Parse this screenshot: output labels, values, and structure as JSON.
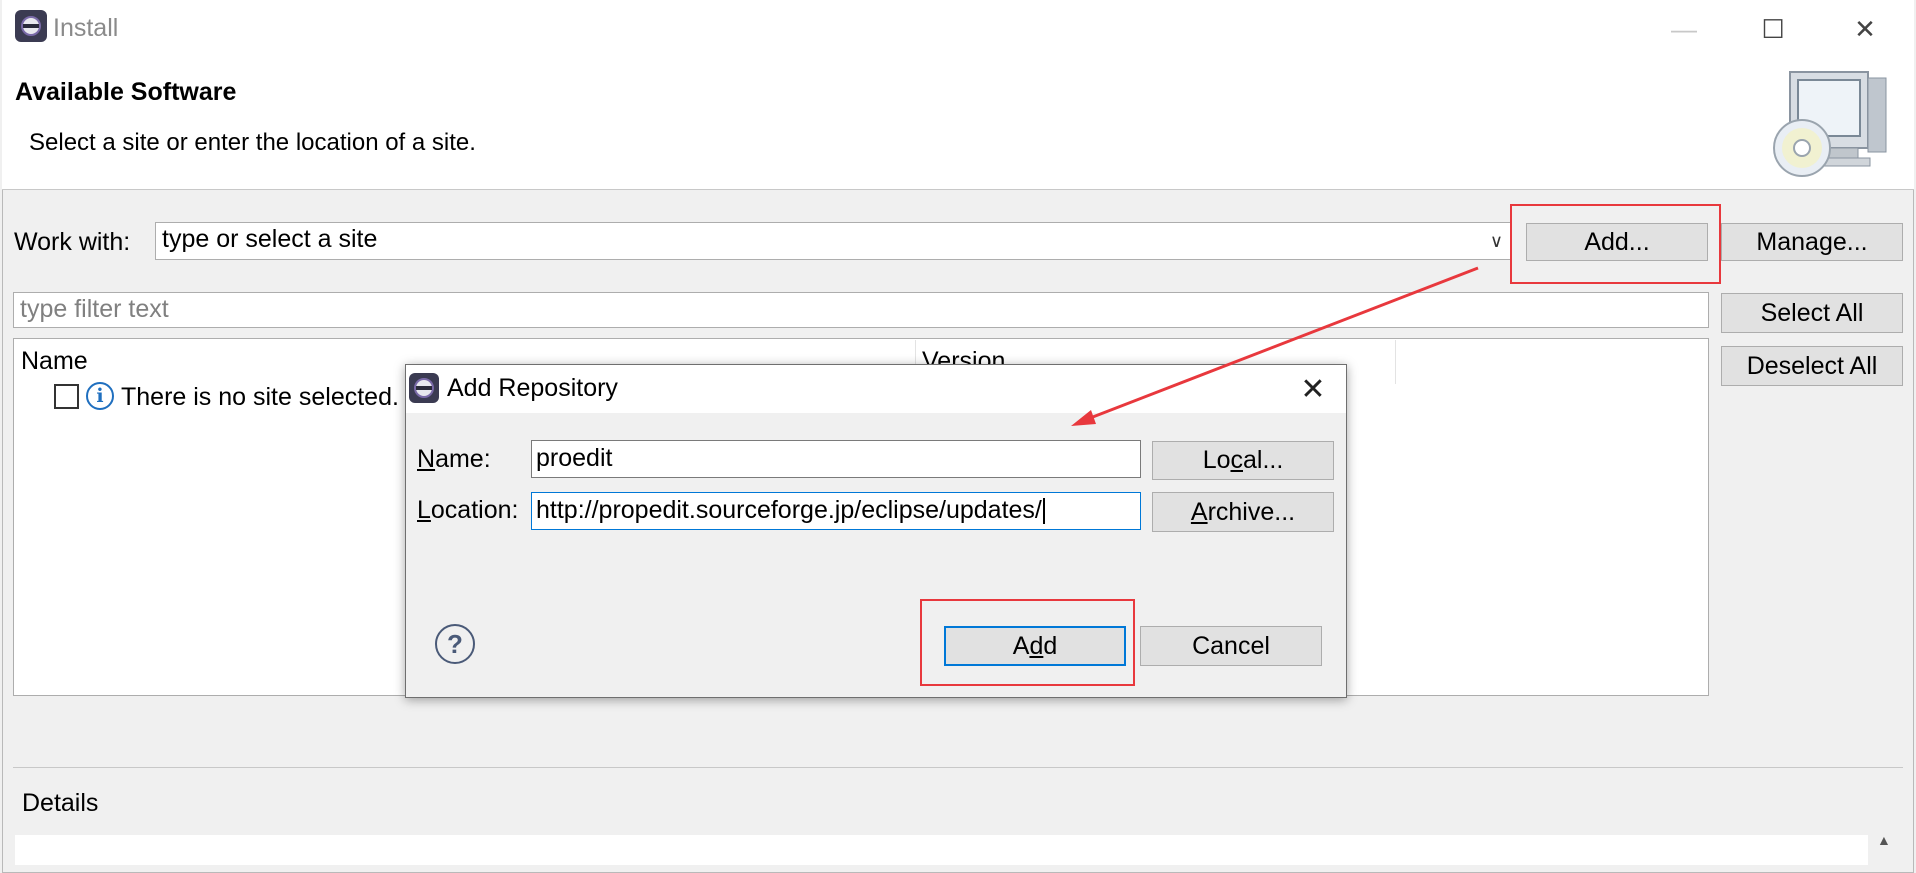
{
  "window": {
    "title": "Install"
  },
  "header": {
    "title": "Available Software",
    "description": "Select a site or enter the location of a site."
  },
  "work_with": {
    "label": "Work with:",
    "combo_value": "type or select a site",
    "add_button": "Add...",
    "manage_button": "Manage..."
  },
  "filter": {
    "placeholder": "type filter text"
  },
  "side_buttons": {
    "select_all": "Select All",
    "deselect_all": "Deselect All"
  },
  "table": {
    "columns": [
      "Name",
      "Version"
    ],
    "rows": [
      {
        "text": "There is no site selected."
      }
    ]
  },
  "details": {
    "label": "Details"
  },
  "dialog": {
    "title": "Add Repository",
    "name_label": "Name:",
    "name_value": "proedit",
    "location_label": "Location:",
    "location_value": "http://propedit.sourceforge.jp/eclipse/updates/",
    "local_button": "Local...",
    "archive_button": "Archive...",
    "add_button": "Add",
    "cancel_button": "Cancel"
  },
  "annotations": {
    "highlight_color": "#e8383d"
  },
  "icons": [
    "eclipse-icon",
    "minimize-icon",
    "maximize-icon",
    "close-icon",
    "monitor-cd-icon",
    "chevron-down-icon",
    "info-icon",
    "help-icon"
  ]
}
